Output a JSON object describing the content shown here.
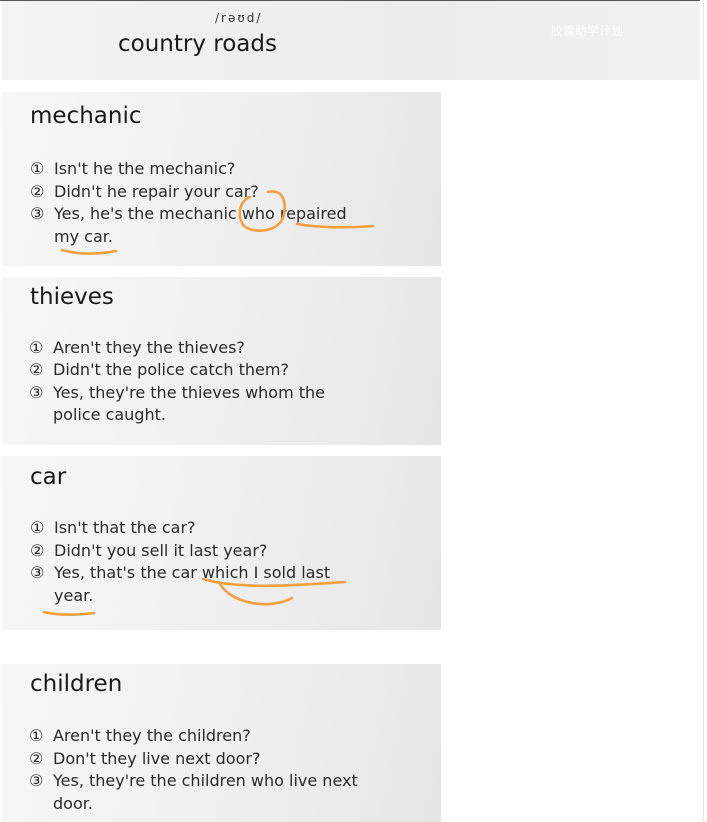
{
  "header": {
    "phonetic": "/rəʊd/",
    "title": "country roads",
    "watermark": "胶囊助学计划"
  },
  "cards": [
    {
      "title": "mechanic",
      "lines": [
        {
          "num": "①",
          "text": "Isn't he the mechanic?"
        },
        {
          "num": "②",
          "text": "Didn't he repair your car?"
        },
        {
          "num": "③",
          "text": "Yes, he's the mechanic who repaired"
        },
        {
          "num": "",
          "text": "my car."
        }
      ]
    },
    {
      "title": "thieves",
      "lines": [
        {
          "num": "①",
          "text": "Aren't they the thieves?"
        },
        {
          "num": "②",
          "text": "Didn't the police catch them?"
        },
        {
          "num": "③",
          "text": "Yes, they're the thieves whom the"
        },
        {
          "num": "",
          "text": "police caught."
        }
      ]
    },
    {
      "title": "car",
      "lines": [
        {
          "num": "①",
          "text": "Isn't that the car?"
        },
        {
          "num": "②",
          "text": "Didn't you sell it last year?"
        },
        {
          "num": "③",
          "text": "Yes, that's the car which I sold last"
        },
        {
          "num": "",
          "text": "year."
        }
      ]
    },
    {
      "title": "children",
      "lines": [
        {
          "num": "①",
          "text": "Aren't they the children?"
        },
        {
          "num": "②",
          "text": "Don't they live next door?"
        },
        {
          "num": "③",
          "text": "Yes, they're the children who live next"
        },
        {
          "num": "",
          "text": "door."
        }
      ]
    }
  ],
  "annotation_color": "#f5a040"
}
